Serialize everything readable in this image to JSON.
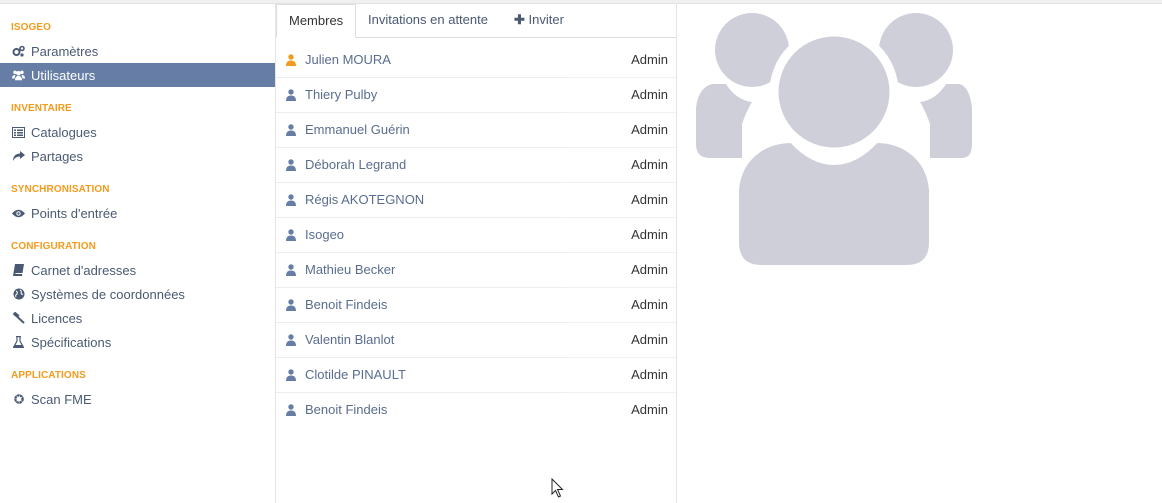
{
  "sidebar": {
    "sections": [
      {
        "title": "ISOGEO",
        "items": [
          {
            "label": "Paramètres",
            "icon": "gears-icon"
          },
          {
            "label": "Utilisateurs",
            "icon": "users-icon",
            "active": true
          }
        ]
      },
      {
        "title": "INVENTAIRE",
        "items": [
          {
            "label": "Catalogues",
            "icon": "list-icon"
          },
          {
            "label": "Partages",
            "icon": "share-icon"
          }
        ]
      },
      {
        "title": "SYNCHRONISATION",
        "items": [
          {
            "label": "Points d'entrée",
            "icon": "eye-icon"
          }
        ]
      },
      {
        "title": "CONFIGURATION",
        "items": [
          {
            "label": "Carnet d'adresses",
            "icon": "book-icon"
          },
          {
            "label": "Systèmes de coordonnées",
            "icon": "globe-icon"
          },
          {
            "label": "Licences",
            "icon": "gavel-icon"
          },
          {
            "label": "Spécifications",
            "icon": "flask-icon"
          }
        ]
      },
      {
        "title": "APPLICATIONS",
        "items": [
          {
            "label": "Scan FME",
            "icon": "gear-icon"
          }
        ]
      }
    ]
  },
  "tabs": {
    "members": "Membres",
    "pending": "Invitations en attente",
    "invite": "Inviter"
  },
  "members": [
    {
      "name": "Julien MOURA",
      "role": "Admin",
      "icon_color": "#f29b1d"
    },
    {
      "name": "Thiery Pulby",
      "role": "Admin"
    },
    {
      "name": "Emmanuel Guérin",
      "role": "Admin"
    },
    {
      "name": "Déborah Legrand",
      "role": "Admin"
    },
    {
      "name": "Régis AKOTEGNON",
      "role": "Admin"
    },
    {
      "name": "Isogeo",
      "role": "Admin"
    },
    {
      "name": "Mathieu Becker",
      "role": "Admin"
    },
    {
      "name": "Benoit Findeis",
      "role": "Admin"
    },
    {
      "name": "Valentin Blanlot",
      "role": "Admin"
    },
    {
      "name": "Clotilde PINAULT",
      "role": "Admin"
    },
    {
      "name": "Benoit Findeis",
      "role": "Admin"
    }
  ],
  "colors": {
    "accent": "#f29b1d",
    "active_bg": "#667ea5",
    "user_icon": "#667ea5",
    "placeholder": "#cfcfd9"
  }
}
